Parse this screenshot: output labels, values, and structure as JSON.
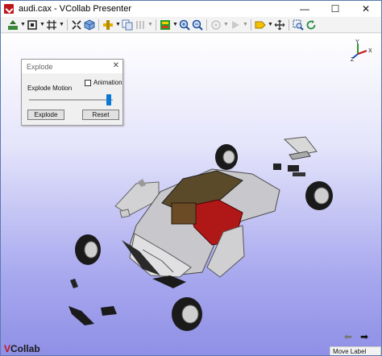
{
  "window": {
    "title": "audi.cax - VCollab Presenter",
    "controls": {
      "minimize": "—",
      "maximize": "☐",
      "close": "✕"
    }
  },
  "toolbar": {
    "buttons": [
      {
        "name": "display-mode-icon",
        "caret": true,
        "color": "#3a8a3a"
      },
      {
        "name": "fit-view-icon",
        "caret": true,
        "color": "#222222"
      },
      {
        "name": "section-plane-icon",
        "caret": true,
        "color": "#222222"
      },
      {
        "name": "explode-icon",
        "caret": false,
        "color": "#222222"
      },
      {
        "name": "parts-cube-icon",
        "caret": false,
        "color": "#2c5fa8"
      },
      {
        "name": "transform-icon",
        "caret": true,
        "color": "#b58b00"
      },
      {
        "name": "copy-view-icon",
        "caret": false,
        "color": "#5577aa"
      },
      {
        "name": "animation-icon",
        "caret": true,
        "color": "#888888"
      },
      {
        "name": "legend-icon",
        "caret": true,
        "color": "#2a9a2a"
      },
      {
        "name": "zoom-in-icon",
        "caret": false,
        "color": "#1b4f9c"
      },
      {
        "name": "zoom-out-icon",
        "caret": false,
        "color": "#1b4f9c"
      },
      {
        "name": "probe-icon",
        "caret": true,
        "color": "#888888"
      },
      {
        "name": "play-icon",
        "caret": true,
        "color": "#999999"
      },
      {
        "name": "label-icon",
        "caret": true,
        "color": "#c89b00"
      },
      {
        "name": "move-icon",
        "caret": false,
        "color": "#333333"
      },
      {
        "name": "zoom-area-icon",
        "caret": false,
        "color": "#1b4f9c"
      },
      {
        "name": "refresh-icon",
        "caret": false,
        "color": "#2a8a4a"
      }
    ]
  },
  "explode_dialog": {
    "title": "Explode",
    "close": "✕",
    "motion_label": "Explode Motion",
    "animation_label": "Animation",
    "animation_checked": false,
    "slider_fraction": 0.98,
    "explode_button": "Explode",
    "reset_button": "Reset"
  },
  "triad": {
    "y": "Y",
    "z": "Z",
    "x": "X"
  },
  "footer": {
    "logo_prefix": "V",
    "logo_text": "Collab",
    "back_arrow": "⬅",
    "forward_arrow": "➡",
    "move_label": "Move Label"
  },
  "colors": {
    "accent": "#0a78d7",
    "viewport_top": "#ffffff",
    "viewport_bottom": "#8f8fe6",
    "car_body": "#c8c8cc",
    "car_interior": "#b01818"
  }
}
